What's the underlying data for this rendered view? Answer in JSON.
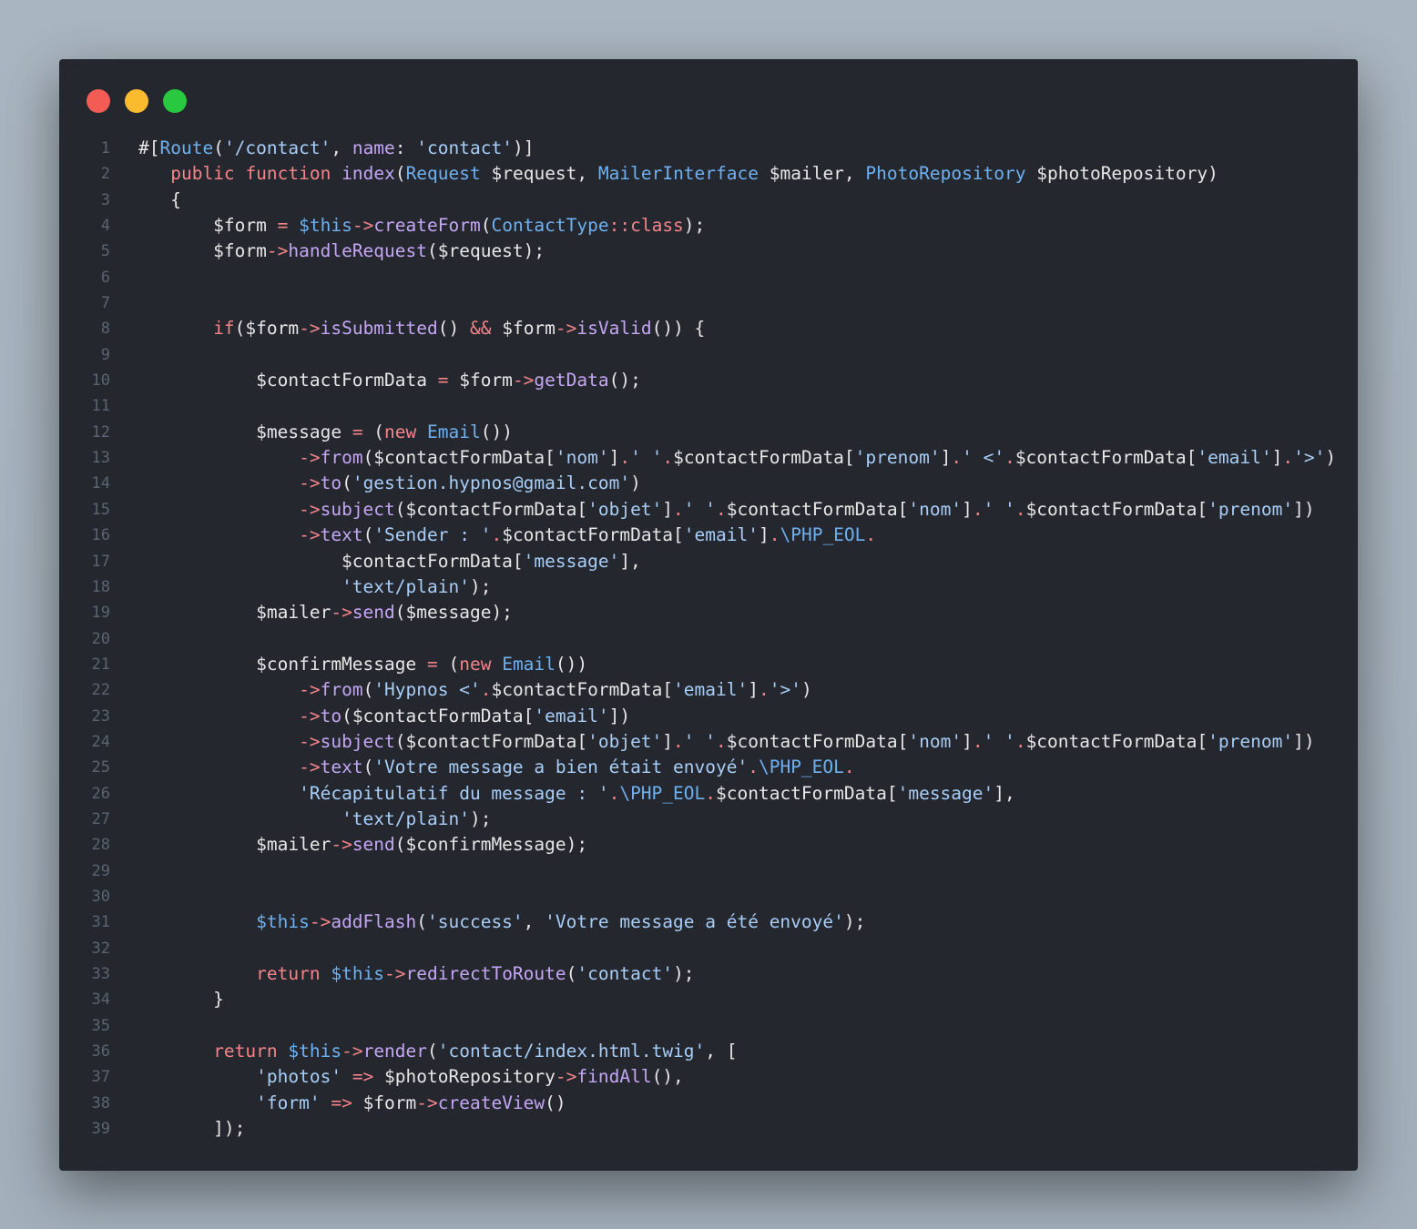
{
  "window": {
    "controls": [
      "close",
      "minimize",
      "maximize"
    ],
    "colors": {
      "close": "#f25c54",
      "minimize": "#fbbb2e",
      "maximize": "#28c840",
      "background": "#24282e",
      "string": "#a8cdf7",
      "keyword": "#f5838a",
      "function": "#c4a6f4",
      "class": "#6fb0f0"
    }
  },
  "code": {
    "lines": [
      {
        "n": "1",
        "tokens": [
          [
            "t",
            "#["
          ],
          [
            "c",
            "Route"
          ],
          [
            "t",
            "("
          ],
          [
            "s",
            "'/contact'"
          ],
          [
            "t",
            ", "
          ],
          [
            "f",
            "name"
          ],
          [
            "t",
            ": "
          ],
          [
            "s",
            "'contact'"
          ],
          [
            "t",
            ")]"
          ]
        ]
      },
      {
        "n": "2",
        "tokens": [
          [
            "t",
            "   "
          ],
          [
            "k",
            "public"
          ],
          [
            "t",
            " "
          ],
          [
            "k",
            "function"
          ],
          [
            "t",
            " "
          ],
          [
            "f",
            "index"
          ],
          [
            "t",
            "("
          ],
          [
            "c",
            "Request"
          ],
          [
            "t",
            " $request, "
          ],
          [
            "c",
            "MailerInterface"
          ],
          [
            "t",
            " $mailer, "
          ],
          [
            "c",
            "PhotoRepository"
          ],
          [
            "t",
            " $photoRepository)"
          ]
        ]
      },
      {
        "n": "3",
        "tokens": [
          [
            "t",
            "   {"
          ]
        ]
      },
      {
        "n": "4",
        "tokens": [
          [
            "t",
            "       $form "
          ],
          [
            "o",
            "="
          ],
          [
            "t",
            " "
          ],
          [
            "v",
            "$this"
          ],
          [
            "o",
            "->"
          ],
          [
            "f",
            "createForm"
          ],
          [
            "t",
            "("
          ],
          [
            "c",
            "ContactType"
          ],
          [
            "o",
            "::"
          ],
          [
            "k",
            "class"
          ],
          [
            "t",
            ");"
          ]
        ]
      },
      {
        "n": "5",
        "tokens": [
          [
            "t",
            "       $form"
          ],
          [
            "o",
            "->"
          ],
          [
            "f",
            "handleRequest"
          ],
          [
            "t",
            "($request);"
          ]
        ]
      },
      {
        "n": "6",
        "tokens": []
      },
      {
        "n": "7",
        "tokens": []
      },
      {
        "n": "8",
        "tokens": [
          [
            "t",
            "       "
          ],
          [
            "k",
            "if"
          ],
          [
            "t",
            "($form"
          ],
          [
            "o",
            "->"
          ],
          [
            "f",
            "isSubmitted"
          ],
          [
            "t",
            "() "
          ],
          [
            "o",
            "&&"
          ],
          [
            "t",
            " $form"
          ],
          [
            "o",
            "->"
          ],
          [
            "f",
            "isValid"
          ],
          [
            "t",
            "()) {"
          ]
        ]
      },
      {
        "n": "9",
        "tokens": []
      },
      {
        "n": "10",
        "tokens": [
          [
            "t",
            "           $contactFormData "
          ],
          [
            "o",
            "="
          ],
          [
            "t",
            " $form"
          ],
          [
            "o",
            "->"
          ],
          [
            "f",
            "getData"
          ],
          [
            "t",
            "();"
          ]
        ]
      },
      {
        "n": "11",
        "tokens": []
      },
      {
        "n": "12",
        "tokens": [
          [
            "t",
            "           $message "
          ],
          [
            "o",
            "="
          ],
          [
            "t",
            " ("
          ],
          [
            "k",
            "new"
          ],
          [
            "t",
            " "
          ],
          [
            "c",
            "Email"
          ],
          [
            "t",
            "())"
          ]
        ]
      },
      {
        "n": "13",
        "tokens": [
          [
            "t",
            "               "
          ],
          [
            "o",
            "->"
          ],
          [
            "f",
            "from"
          ],
          [
            "t",
            "($contactFormData["
          ],
          [
            "s",
            "'nom'"
          ],
          [
            "t",
            "]"
          ],
          [
            "o",
            "."
          ],
          [
            "s",
            "' '"
          ],
          [
            "o",
            "."
          ],
          [
            "t",
            "$contactFormData["
          ],
          [
            "s",
            "'prenom'"
          ],
          [
            "t",
            "]"
          ],
          [
            "o",
            "."
          ],
          [
            "s",
            "' <'"
          ],
          [
            "o",
            "."
          ],
          [
            "t",
            "$contactFormData["
          ],
          [
            "s",
            "'email'"
          ],
          [
            "t",
            "]"
          ],
          [
            "o",
            "."
          ],
          [
            "s",
            "'>'"
          ],
          [
            "t",
            ")"
          ]
        ]
      },
      {
        "n": "14",
        "tokens": [
          [
            "t",
            "               "
          ],
          [
            "o",
            "->"
          ],
          [
            "f",
            "to"
          ],
          [
            "t",
            "("
          ],
          [
            "s",
            "'gestion.hypnos@gmail.com'"
          ],
          [
            "t",
            ")"
          ]
        ]
      },
      {
        "n": "15",
        "tokens": [
          [
            "t",
            "               "
          ],
          [
            "o",
            "->"
          ],
          [
            "f",
            "subject"
          ],
          [
            "t",
            "($contactFormData["
          ],
          [
            "s",
            "'objet'"
          ],
          [
            "t",
            "]"
          ],
          [
            "o",
            "."
          ],
          [
            "s",
            "' '"
          ],
          [
            "o",
            "."
          ],
          [
            "t",
            "$contactFormData["
          ],
          [
            "s",
            "'nom'"
          ],
          [
            "t",
            "]"
          ],
          [
            "o",
            "."
          ],
          [
            "s",
            "' '"
          ],
          [
            "o",
            "."
          ],
          [
            "t",
            "$contactFormData["
          ],
          [
            "s",
            "'prenom'"
          ],
          [
            "t",
            "])"
          ]
        ]
      },
      {
        "n": "16",
        "tokens": [
          [
            "t",
            "               "
          ],
          [
            "o",
            "->"
          ],
          [
            "f",
            "text"
          ],
          [
            "t",
            "("
          ],
          [
            "s",
            "'Sender : '"
          ],
          [
            "o",
            "."
          ],
          [
            "t",
            "$contactFormData["
          ],
          [
            "s",
            "'email'"
          ],
          [
            "t",
            "]"
          ],
          [
            "o",
            "."
          ],
          [
            "c",
            "\\PHP_EOL"
          ],
          [
            "o",
            "."
          ]
        ]
      },
      {
        "n": "17",
        "tokens": [
          [
            "t",
            "                   $contactFormData["
          ],
          [
            "s",
            "'message'"
          ],
          [
            "t",
            "],"
          ]
        ]
      },
      {
        "n": "18",
        "tokens": [
          [
            "t",
            "                   "
          ],
          [
            "s",
            "'text/plain'"
          ],
          [
            "t",
            ");"
          ]
        ]
      },
      {
        "n": "19",
        "tokens": [
          [
            "t",
            "           $mailer"
          ],
          [
            "o",
            "->"
          ],
          [
            "f",
            "send"
          ],
          [
            "t",
            "($message);"
          ]
        ]
      },
      {
        "n": "20",
        "tokens": []
      },
      {
        "n": "21",
        "tokens": [
          [
            "t",
            "           $confirmMessage "
          ],
          [
            "o",
            "="
          ],
          [
            "t",
            " ("
          ],
          [
            "k",
            "new"
          ],
          [
            "t",
            " "
          ],
          [
            "c",
            "Email"
          ],
          [
            "t",
            "())"
          ]
        ]
      },
      {
        "n": "22",
        "tokens": [
          [
            "t",
            "               "
          ],
          [
            "o",
            "->"
          ],
          [
            "f",
            "from"
          ],
          [
            "t",
            "("
          ],
          [
            "s",
            "'Hypnos <'"
          ],
          [
            "o",
            "."
          ],
          [
            "t",
            "$contactFormData["
          ],
          [
            "s",
            "'email'"
          ],
          [
            "t",
            "]"
          ],
          [
            "o",
            "."
          ],
          [
            "s",
            "'>'"
          ],
          [
            "t",
            ")"
          ]
        ]
      },
      {
        "n": "23",
        "tokens": [
          [
            "t",
            "               "
          ],
          [
            "o",
            "->"
          ],
          [
            "f",
            "to"
          ],
          [
            "t",
            "($contactFormData["
          ],
          [
            "s",
            "'email'"
          ],
          [
            "t",
            "])"
          ]
        ]
      },
      {
        "n": "24",
        "tokens": [
          [
            "t",
            "               "
          ],
          [
            "o",
            "->"
          ],
          [
            "f",
            "subject"
          ],
          [
            "t",
            "($contactFormData["
          ],
          [
            "s",
            "'objet'"
          ],
          [
            "t",
            "]"
          ],
          [
            "o",
            "."
          ],
          [
            "s",
            "' '"
          ],
          [
            "o",
            "."
          ],
          [
            "t",
            "$contactFormData["
          ],
          [
            "s",
            "'nom'"
          ],
          [
            "t",
            "]"
          ],
          [
            "o",
            "."
          ],
          [
            "s",
            "' '"
          ],
          [
            "o",
            "."
          ],
          [
            "t",
            "$contactFormData["
          ],
          [
            "s",
            "'prenom'"
          ],
          [
            "t",
            "])"
          ]
        ]
      },
      {
        "n": "25",
        "tokens": [
          [
            "t",
            "               "
          ],
          [
            "o",
            "->"
          ],
          [
            "f",
            "text"
          ],
          [
            "t",
            "("
          ],
          [
            "s",
            "'Votre message a bien était envoyé'"
          ],
          [
            "o",
            "."
          ],
          [
            "c",
            "\\PHP_EOL"
          ],
          [
            "o",
            "."
          ]
        ]
      },
      {
        "n": "26",
        "tokens": [
          [
            "t",
            "               "
          ],
          [
            "s",
            "'Récapitulatif du message : '"
          ],
          [
            "o",
            "."
          ],
          [
            "c",
            "\\PHP_EOL"
          ],
          [
            "o",
            "."
          ],
          [
            "t",
            "$contactFormData["
          ],
          [
            "s",
            "'message'"
          ],
          [
            "t",
            "],"
          ]
        ]
      },
      {
        "n": "27",
        "tokens": [
          [
            "t",
            "                   "
          ],
          [
            "s",
            "'text/plain'"
          ],
          [
            "t",
            ");"
          ]
        ]
      },
      {
        "n": "28",
        "tokens": [
          [
            "t",
            "           $mailer"
          ],
          [
            "o",
            "->"
          ],
          [
            "f",
            "send"
          ],
          [
            "t",
            "($confirmMessage);"
          ]
        ]
      },
      {
        "n": "29",
        "tokens": []
      },
      {
        "n": "30",
        "tokens": []
      },
      {
        "n": "31",
        "tokens": [
          [
            "t",
            "           "
          ],
          [
            "v",
            "$this"
          ],
          [
            "o",
            "->"
          ],
          [
            "f",
            "addFlash"
          ],
          [
            "t",
            "("
          ],
          [
            "s",
            "'success'"
          ],
          [
            "t",
            ", "
          ],
          [
            "s",
            "'Votre message a été envoyé'"
          ],
          [
            "t",
            ");"
          ]
        ]
      },
      {
        "n": "32",
        "tokens": []
      },
      {
        "n": "33",
        "tokens": [
          [
            "t",
            "           "
          ],
          [
            "k",
            "return"
          ],
          [
            "t",
            " "
          ],
          [
            "v",
            "$this"
          ],
          [
            "o",
            "->"
          ],
          [
            "f",
            "redirectToRoute"
          ],
          [
            "t",
            "("
          ],
          [
            "s",
            "'contact'"
          ],
          [
            "t",
            ");"
          ]
        ]
      },
      {
        "n": "34",
        "tokens": [
          [
            "t",
            "       }"
          ]
        ]
      },
      {
        "n": "35",
        "tokens": []
      },
      {
        "n": "36",
        "tokens": [
          [
            "t",
            "       "
          ],
          [
            "k",
            "return"
          ],
          [
            "t",
            " "
          ],
          [
            "v",
            "$this"
          ],
          [
            "o",
            "->"
          ],
          [
            "f",
            "render"
          ],
          [
            "t",
            "("
          ],
          [
            "s",
            "'contact/index.html.twig'"
          ],
          [
            "t",
            ", ["
          ]
        ]
      },
      {
        "n": "37",
        "tokens": [
          [
            "t",
            "           "
          ],
          [
            "s",
            "'photos'"
          ],
          [
            "t",
            " "
          ],
          [
            "o",
            "=>"
          ],
          [
            "t",
            " $photoRepository"
          ],
          [
            "o",
            "->"
          ],
          [
            "f",
            "findAll"
          ],
          [
            "t",
            "(),"
          ]
        ]
      },
      {
        "n": "38",
        "tokens": [
          [
            "t",
            "           "
          ],
          [
            "s",
            "'form'"
          ],
          [
            "t",
            " "
          ],
          [
            "o",
            "=>"
          ],
          [
            "t",
            " $form"
          ],
          [
            "o",
            "->"
          ],
          [
            "f",
            "createView"
          ],
          [
            "t",
            "()"
          ]
        ]
      },
      {
        "n": "39",
        "tokens": [
          [
            "t",
            "       ]);"
          ]
        ]
      }
    ]
  }
}
